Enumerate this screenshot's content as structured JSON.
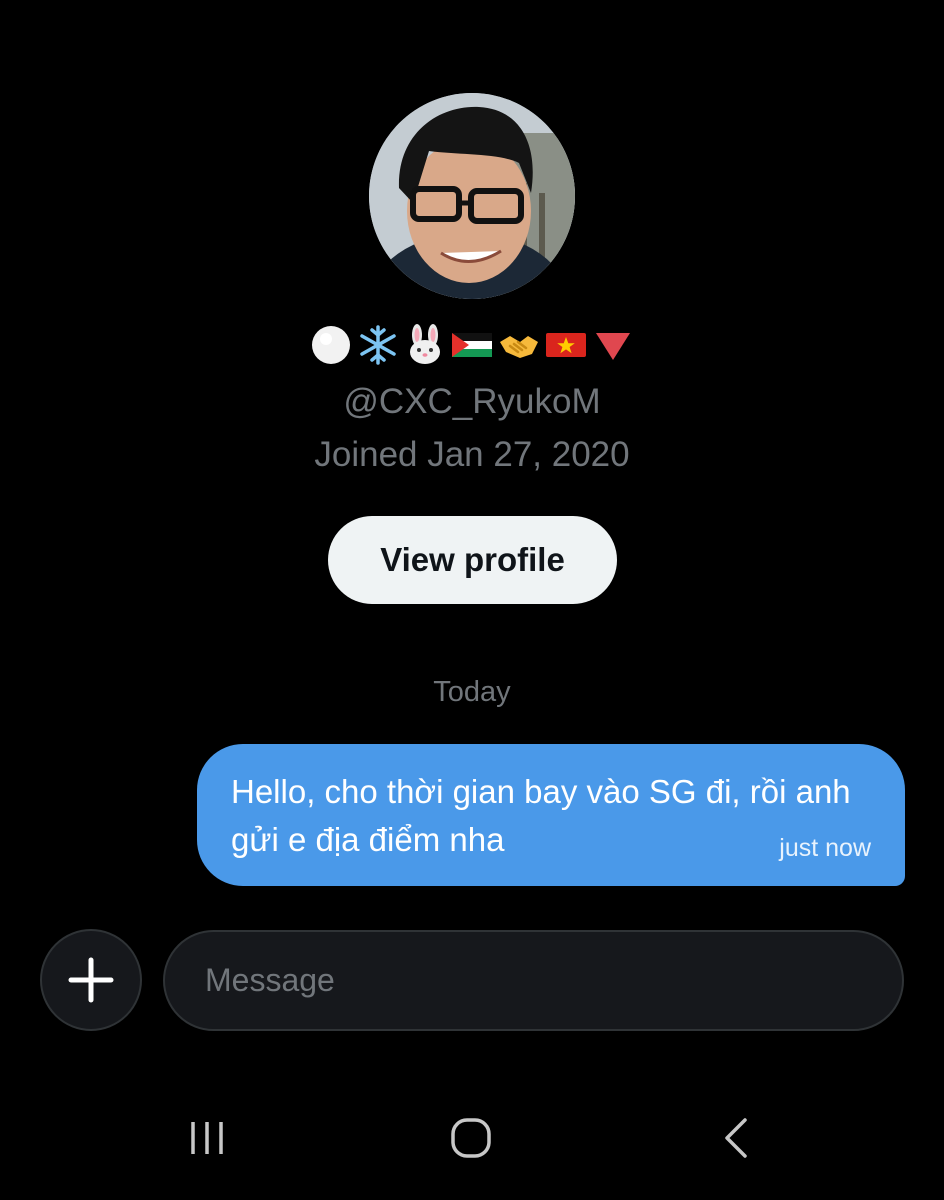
{
  "profile": {
    "avatar_alt": "avatar",
    "emoji_badges": [
      "white-circle",
      "snowflake",
      "rabbit-face",
      "palestine-flag",
      "handshake",
      "vietnam-flag",
      "red-triangle-down"
    ],
    "handle": "@CXC_RyukoM",
    "joined": "Joined Jan 27, 2020",
    "view_profile_label": "View profile"
  },
  "conversation": {
    "day_separator": "Today",
    "messages": [
      {
        "text": "Hello, cho thời gian bay vào SG đi, rồi anh gửi e địa điểm nha",
        "time": "just now",
        "outgoing": true
      }
    ]
  },
  "composer": {
    "add_icon": "plus-icon",
    "placeholder": "Message"
  },
  "system_nav": {
    "buttons": [
      "recent-apps-icon",
      "home-icon",
      "back-icon"
    ]
  },
  "colors": {
    "background": "#000000",
    "bubble": "#4a99e9",
    "secondary_text": "#71767b",
    "button_bg": "#eff3f4",
    "input_bg": "#16181c"
  }
}
